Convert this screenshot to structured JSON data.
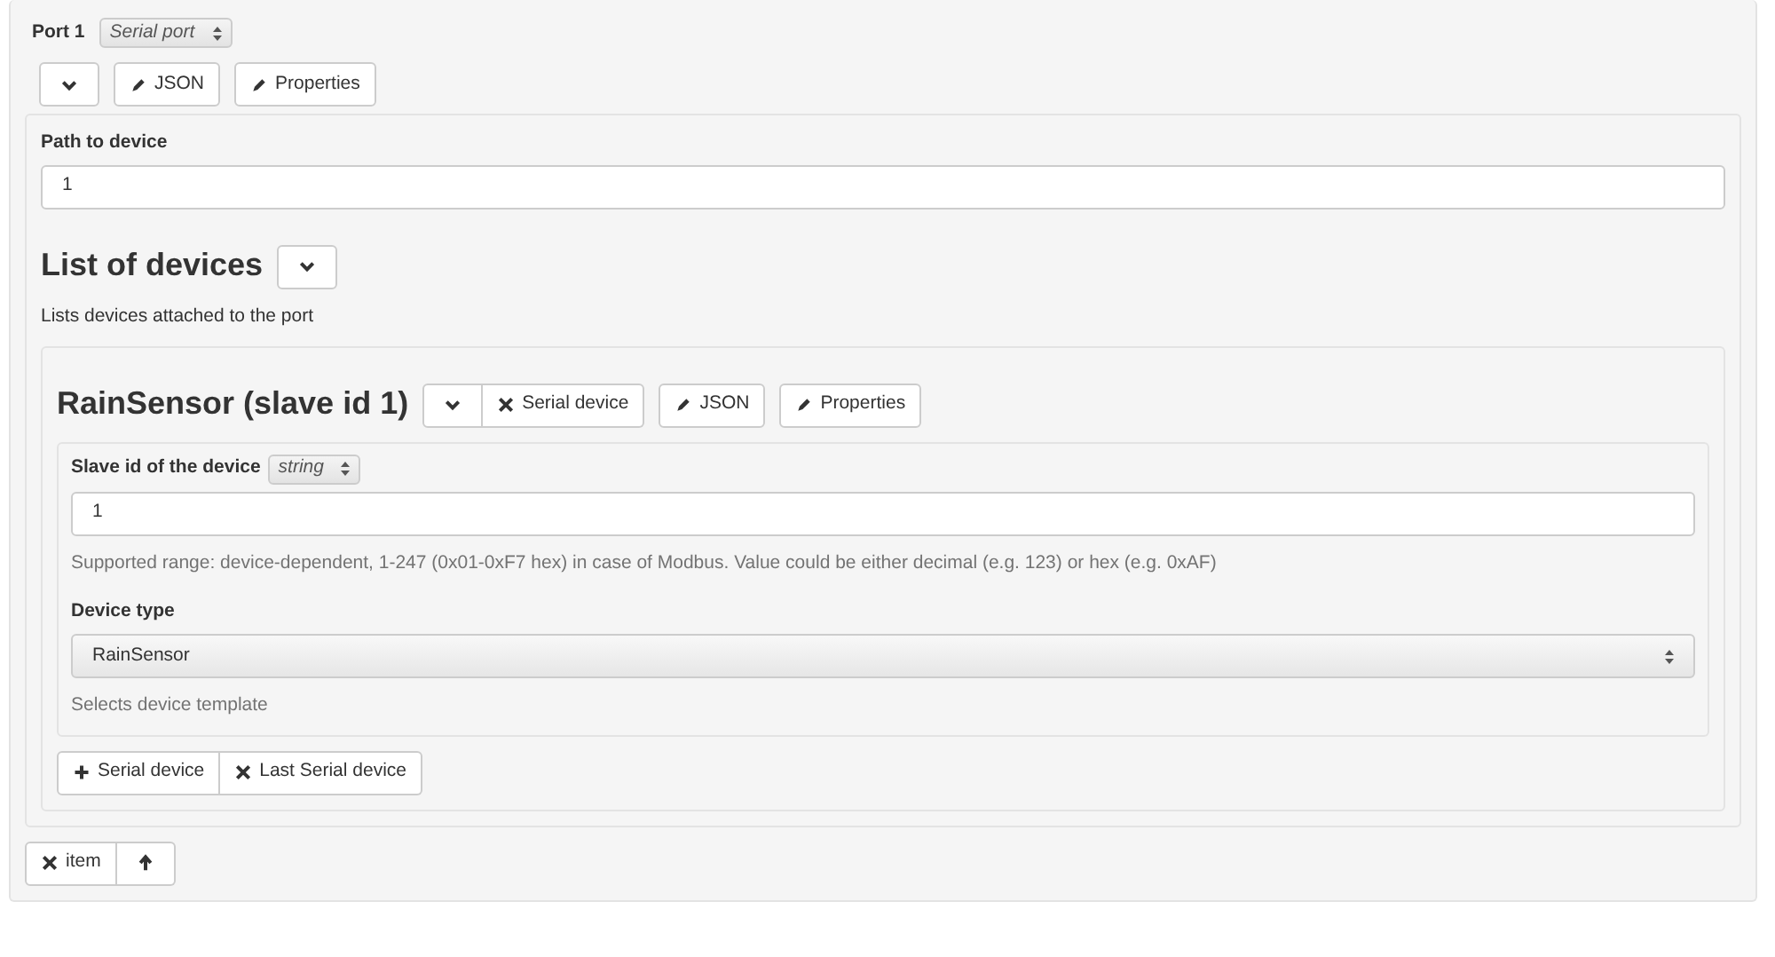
{
  "port": {
    "title": "Port 1",
    "type_select": "Serial port",
    "toolbar": [
      [
        {
          "kind": "collapse"
        }
      ],
      [
        {
          "kind": "edit",
          "label": "JSON"
        }
      ],
      [
        {
          "kind": "edit",
          "label": "Properties"
        }
      ]
    ],
    "path_field": {
      "label": "Path to device",
      "value": "1"
    },
    "devices_section": {
      "title": "List of devices",
      "toolbar": [
        [
          {
            "kind": "collapse"
          }
        ]
      ],
      "description": "Lists devices attached to the port",
      "device": {
        "title": "RainSensor (slave id 1)",
        "toolbar": [
          [
            {
              "kind": "collapse"
            },
            {
              "kind": "remove",
              "label": "Serial device"
            }
          ],
          [
            {
              "kind": "edit",
              "label": "JSON"
            }
          ],
          [
            {
              "kind": "edit",
              "label": "Properties"
            }
          ]
        ],
        "slave_id": {
          "label": "Slave id of the device",
          "type_select": "string",
          "value": "1",
          "help": "Supported range: device-dependent, 1-247 (0x01-0xF7 hex) in case of Modbus. Value could be either decimal (e.g. 123) or hex (e.g. 0xAF)"
        },
        "device_type": {
          "label": "Device type",
          "value": "RainSensor",
          "help": "Selects device template"
        }
      },
      "footer": [
        [
          {
            "kind": "add",
            "label": "Serial device"
          },
          {
            "kind": "remove",
            "label": "Last Serial device"
          }
        ]
      ]
    },
    "footer": [
      [
        {
          "kind": "remove",
          "label": "item"
        },
        {
          "kind": "move-up"
        }
      ]
    ]
  }
}
